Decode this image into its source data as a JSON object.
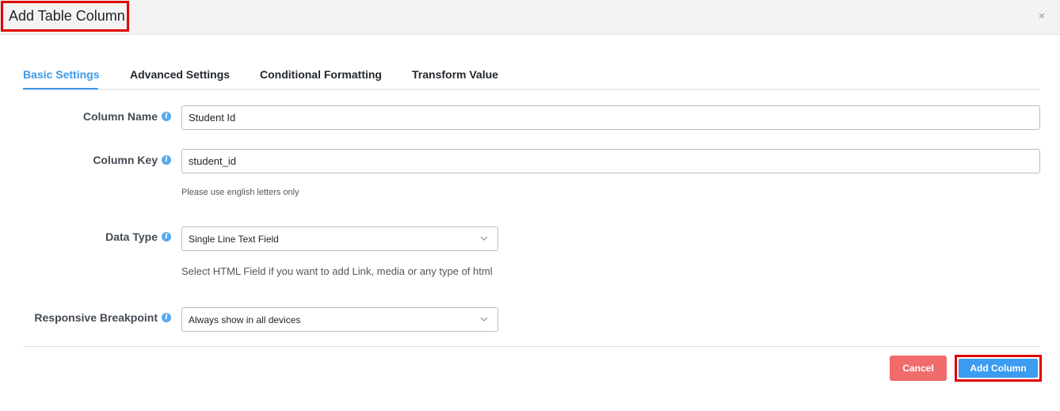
{
  "modal": {
    "title": "Add Table Column",
    "close_icon": "×"
  },
  "tabs": [
    {
      "label": "Basic Settings",
      "active": true
    },
    {
      "label": "Advanced Settings",
      "active": false
    },
    {
      "label": "Conditional Formatting",
      "active": false
    },
    {
      "label": "Transform Value",
      "active": false
    }
  ],
  "fields": {
    "column_name": {
      "label": "Column Name",
      "value": "Student Id"
    },
    "column_key": {
      "label": "Column Key",
      "value": "student_id",
      "help": "Please use english letters only"
    },
    "data_type": {
      "label": "Data Type",
      "value": "Single Line Text Field",
      "help": "Select HTML Field if you want to add Link, media or any type of html"
    },
    "responsive_breakpoint": {
      "label": "Responsive Breakpoint",
      "value": "Always show in all devices"
    }
  },
  "footer": {
    "cancel_label": "Cancel",
    "add_label": "Add Column"
  },
  "colors": {
    "accent": "#3c99e8",
    "cancel": "#f06b6b",
    "primary_button": "#3c9cf0",
    "highlight": "#e00000"
  }
}
